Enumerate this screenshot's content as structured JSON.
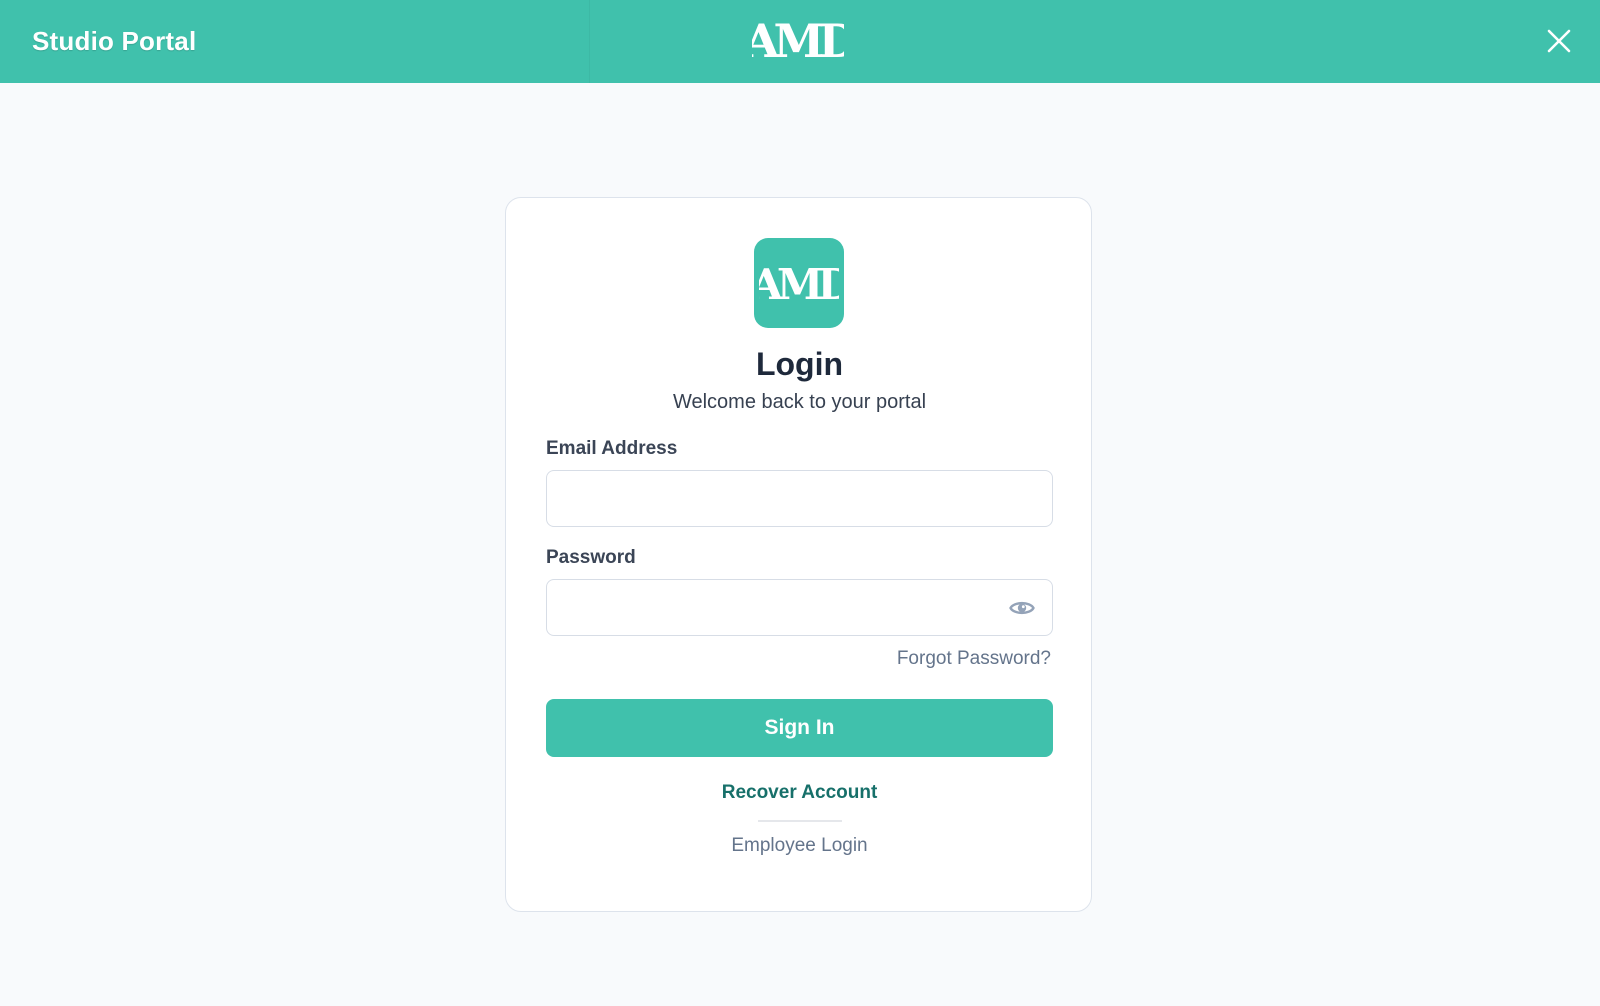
{
  "header": {
    "app_title": "Studio Portal",
    "logo_text": "AMD",
    "close_icon": "close-icon"
  },
  "login_card": {
    "logo_text": "AMD",
    "title": "Login",
    "subtitle": "Welcome back to your portal",
    "email": {
      "label": "Email Address",
      "value": "",
      "placeholder": ""
    },
    "password": {
      "label": "Password",
      "value": "",
      "placeholder": "",
      "toggle_icon": "eye-icon"
    },
    "forgot_password": "Forgot Password?",
    "sign_in": "Sign In",
    "recover_account": "Recover Account",
    "employee_login": "Employee Login"
  },
  "colors": {
    "brand": "#40c1ac",
    "link_dark": "#17706a",
    "background": "#f8fafc"
  }
}
